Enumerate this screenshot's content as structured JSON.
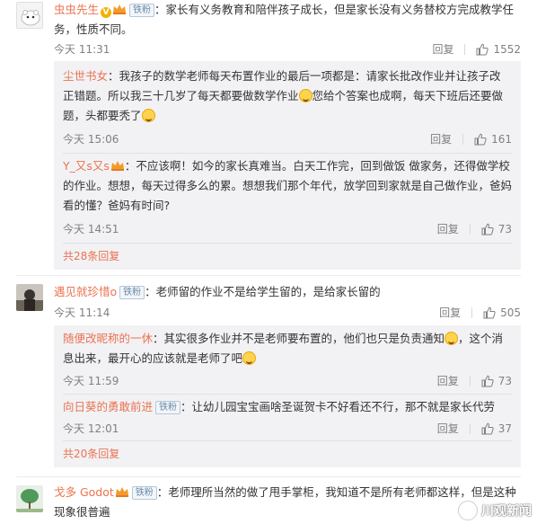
{
  "comments": [
    {
      "user": "虫虫先生",
      "fan_badge": "铁粉",
      "text": "：家长有义务教育和陪伴孩子成长，但是家长没有义务替校方完成教学任务，性质不同。",
      "time": "今天 11:31",
      "reply_label": "回复",
      "likes": "1552",
      "replies": [
        {
          "user": "尘世书女",
          "text_a": "：我孩子的数学老师每天布置作业的最后一项都是：请家长批改作业并让孩子改正错题。所以我三十几岁了每天都要做数学作业",
          "text_b": "您给个答案也成啊，每天下班后还要做题，头都要秃了",
          "time": "今天 15:06",
          "reply_label": "回复",
          "likes": "161"
        },
        {
          "user": "Y_又s又s",
          "text": "：不应该啊！如今的家长真难当。白天工作完，回到做饭 做家务，还得做学校的作业。想想，每天过得多么的累。想想我们那个年代，放学回到家就是自己做作业，爸妈看的懂？爸妈有时间?",
          "time": "今天 14:51",
          "reply_label": "回复",
          "likes": "73"
        }
      ],
      "more_replies": "共28条回复"
    },
    {
      "user": "遇见就珍惜o",
      "fan_badge": "铁粉",
      "text": "：老师留的作业不是给学生留的，是给家长留的",
      "time": "今天 11:14",
      "reply_label": "回复",
      "likes": "505",
      "replies": [
        {
          "user": "随便改昵称的一休",
          "text_a": "：其实很多作业并不是老师要布置的，他们也只是负责通知",
          "text_b": "，这个消息出来，最开心的应该就是老师了吧",
          "time": "今天 11:59",
          "reply_label": "回复",
          "likes": "73"
        },
        {
          "user": "向日葵的勇敢前进",
          "fan_badge": "铁粉",
          "text": "：让幼儿园宝宝画啥圣诞贺卡不好看还不行，那不就是家长代劳",
          "time": "今天 12:01",
          "reply_label": "回复",
          "likes": "37"
        }
      ],
      "more_replies": "共20条回复"
    },
    {
      "user": "戈多 Godot",
      "fan_badge": "铁粉",
      "text": "：老师理所当然的做了甩手掌柜，我知道不是所有老师都这样，但是这种现象很普遍"
    }
  ],
  "watermark": "川观新闻",
  "colors": {
    "username": "#eb7350",
    "meta": "#808080",
    "sub_bg": "#f2f2f5"
  }
}
